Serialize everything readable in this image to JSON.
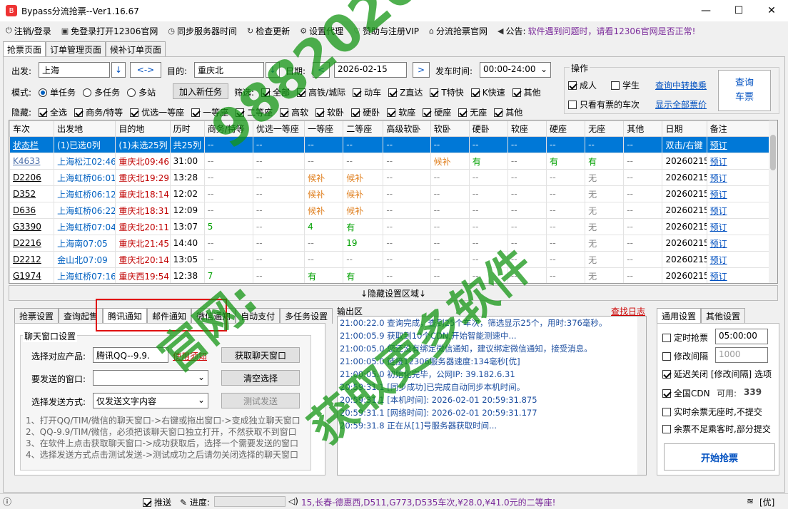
{
  "window": {
    "title": "Bypass分流抢票--Ver1.16.67"
  },
  "menu": [
    {
      "label": "注销/登录",
      "icon": "logout-icon"
    },
    {
      "label": "免登录打开12306官网",
      "icon": "browser-icon"
    },
    {
      "label": "同步服务器时间",
      "icon": "clock-icon"
    },
    {
      "label": "检查更新",
      "icon": "refresh-icon"
    },
    {
      "label": "设置代理",
      "icon": "gear-icon"
    },
    {
      "label": "赞助与注册VIP",
      "icon": "heart-icon"
    },
    {
      "label": "分流抢票官网",
      "icon": "home-icon"
    }
  ],
  "notice": {
    "label": "公告:",
    "text": "软件遇到问题时，请看12306官网是否正常!"
  },
  "main_tabs": [
    "抢票页面",
    "订单管理页面",
    "候补订单页面"
  ],
  "query": {
    "from_label": "出发:",
    "from_value": "上海",
    "swap_label": "<->",
    "to_label": "目的:",
    "to_value": "重庆北",
    "date_label": "日期:",
    "date_value": "2026-02-15",
    "time_label": "发车时间:",
    "time_value": "00:00-24:00",
    "prev": "<",
    "next": ">"
  },
  "mode": {
    "label": "模式:",
    "options": [
      "单任务",
      "多任务",
      "多站"
    ],
    "selected": 0,
    "add_task": "加入新任务"
  },
  "filter": {
    "label": "筛选:",
    "items": [
      "全部",
      "高铁/城际",
      "动车",
      "Z直达",
      "T特快",
      "K快速",
      "其他"
    ]
  },
  "hide": {
    "label": "隐藏:",
    "items": [
      "全选",
      "商务/特等",
      "优选一等座",
      "一等座",
      "二等座",
      "高软",
      "软卧",
      "硬卧",
      "软座",
      "硬座",
      "无座",
      "其他"
    ]
  },
  "ops": {
    "title": "操作",
    "adult": "成人",
    "student": "学生",
    "transfer_link": "查询中转换乘",
    "only_tickets": "只看有票的车次",
    "show_all_price": "显示全部票价",
    "query_button": "查询\n车票"
  },
  "table": {
    "headers": [
      "车次",
      "出发地",
      "目的地",
      "历时",
      "商务/特等",
      "优选一等座",
      "一等座",
      "二等座",
      "高级软卧",
      "软卧",
      "硬卧",
      "软座",
      "硬座",
      "无座",
      "其他",
      "日期",
      "备注"
    ],
    "rows": [
      [
        "状态栏",
        "(1)已选0列",
        "(1)未选25列",
        "共25列",
        "--",
        "--",
        "--",
        "--",
        "--",
        "--",
        "--",
        "--",
        "--",
        "--",
        "--",
        "双击/右键",
        "预订"
      ],
      [
        "K4633",
        "上海松江02:46",
        "重庆北09:46",
        "31:00",
        "--",
        "--",
        "--",
        "--",
        "--",
        "候补",
        "有",
        "--",
        "有",
        "有",
        "--",
        "20260215",
        "预订"
      ],
      [
        "D2206",
        "上海虹桥06:01",
        "重庆北19:29",
        "13:28",
        "--",
        "--",
        "候补",
        "候补",
        "--",
        "--",
        "--",
        "--",
        "--",
        "无",
        "--",
        "20260215",
        "预订"
      ],
      [
        "D352",
        "上海虹桥06:12",
        "重庆北18:14",
        "12:02",
        "--",
        "--",
        "候补",
        "候补",
        "--",
        "--",
        "--",
        "--",
        "--",
        "无",
        "--",
        "20260215",
        "预订"
      ],
      [
        "D636",
        "上海虹桥06:22",
        "重庆北18:31",
        "12:09",
        "--",
        "--",
        "候补",
        "候补",
        "--",
        "--",
        "--",
        "--",
        "--",
        "无",
        "--",
        "20260215",
        "预订"
      ],
      [
        "G3390",
        "上海虹桥07:04",
        "重庆北20:11",
        "13:07",
        "5",
        "--",
        "4",
        "有",
        "--",
        "--",
        "--",
        "--",
        "--",
        "无",
        "--",
        "20260215",
        "预订"
      ],
      [
        "D2216",
        "上海南07:05",
        "重庆北21:45",
        "14:40",
        "--",
        "--",
        "--",
        "19",
        "--",
        "--",
        "--",
        "--",
        "--",
        "无",
        "--",
        "20260215",
        "预订"
      ],
      [
        "D2212",
        "金山北07:09",
        "重庆北20:14",
        "13:05",
        "--",
        "--",
        "--",
        "--",
        "--",
        "--",
        "--",
        "--",
        "--",
        "无",
        "--",
        "20260215",
        "预订"
      ],
      [
        "G1974",
        "上海虹桥07:16",
        "重庆西19:54",
        "12:38",
        "7",
        "--",
        "有",
        "有",
        "--",
        "--",
        "--",
        "--",
        "--",
        "无",
        "--",
        "20260215",
        "预订"
      ]
    ]
  },
  "divider_label": "↓隐藏设置区域↓",
  "bottom_tabs": [
    "抢票设置",
    "查询起售",
    "腾讯通知",
    "邮件通知",
    "微信通知",
    "自动支付",
    "多任务设置"
  ],
  "chat": {
    "group_title": "聊天窗口设置",
    "product_label": "选择对应产品:",
    "product_value": "腾讯QQ--9.9.",
    "help_link": "使用须知",
    "get_window": "获取聊天窗口",
    "window_label": "要发送的窗口:",
    "clear": "清空选择",
    "send_mode_label": "选择发送方式:",
    "send_mode_value": "仅发送文字内容",
    "test_send": "测试发送",
    "help_lines": [
      "1、打开QQ/TIM/微信的聊天窗口->右键或拖出窗口->变成独立聊天窗口",
      "2、QQ-9.9/TIM/微信，必须把该聊天窗口独立打开，不然获取不到窗口",
      "3、在软件上点击获取聊天窗口->成功获取后，选择一个需要发送的窗口",
      "4、选择发送方式点击测试发送->测试成功之后请勿关闭选择的聊天窗口"
    ]
  },
  "output": {
    "title": "输出区",
    "find_log": "查找日志",
    "lines": [
      "21:00:22.0  查询完成，查到25个车次，筛选显示25个，用时:376毫秒。",
      "21:00:05.9  获取到10个CDN,开始智能测速中...",
      "21:00:05.0  您还没有绑定微信通知，建议绑定微信通知，接受消息。",
      "21:00:05.0  链接12306服务器速度:134毫秒[优]",
      "21:00:05.0  初始化完毕，公网IP: 39.182.6.31",
      "20:59:31.1  [同步成功]已完成自动同步本机时间。",
      "20:59:31.1  [本机时间]: 2026-02-01 20:59:31.875",
      "20:59:31.1  [网络时间]: 2026-02-01 20:59:31.177",
      "20:59:31.8  正在从[1]号服务器获取时间..."
    ]
  },
  "right_tabs": [
    "通用设置",
    "其他设置"
  ],
  "settings": {
    "timed": "定时抢票",
    "timed_value": "05:00:00",
    "modify_interval": "修改间隔",
    "interval_value": "1000",
    "delay_close": "延迟关闭 [修改间隔] 选项",
    "global_cdn": "全国CDN",
    "cdn_available": "可用:",
    "cdn_count": "339",
    "realtime": "实时余票无座时,不提交",
    "insufficient": "余票不足乘客时,部分提交",
    "start": "开始抢票"
  },
  "status": {
    "push": "推送",
    "progress": "进度:",
    "ticker": "15,长春-德惠西,D511,G773,D535车次,¥28.0,¥41.0元的二等座!",
    "net": "[优]"
  },
  "watermark": {
    "line1": "9882026.com",
    "line2": "官网:",
    "line3": "获取更多软件"
  }
}
